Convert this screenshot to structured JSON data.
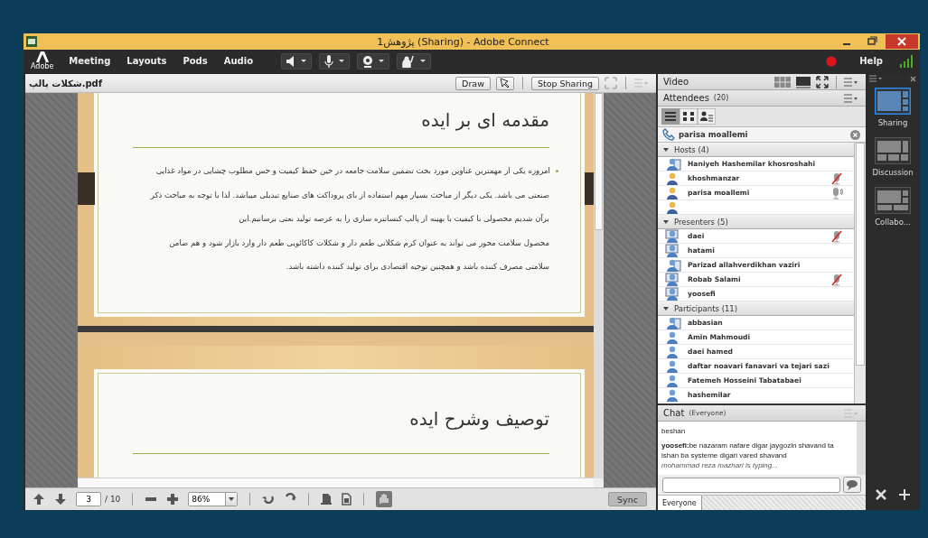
{
  "window": {
    "title": "پژوهش1 (Sharing) - Adobe Connect",
    "logo": "Adobe"
  },
  "menu": [
    "Meeting",
    "Layouts",
    "Pods",
    "Audio"
  ],
  "help": "Help",
  "share_pod": {
    "file": "شكلات پالپ.pdf",
    "buttons": [
      "Draw",
      "Stop Sharing"
    ],
    "slides": [
      {
        "title": "مقدمه ای بر ایده",
        "lines": [
          "امروزه یکی از مهمترین عناوین مورد بحث تضمین سلامت جامعه در حین حفظ کیفیت و حس مطلوب چشایی در مواد غذایی",
          "صنعتی می باشد. یکی دیگر از مباحث بسیار مهم استفاده از بای پروداکت های صنایع تبدیلی میباشد. لذا با توجه به مباحث ذکر",
          "برآن شدیم    محصولی با کیفیت با           بهینه از پالپ           کنسانتره سازی را به عرصه تولید    نعتی برسانیم.این",
          "محصول سلامت محور می تواند به عنوان کرم شکلاتی طعم دار و شکلات کاکائویی طعم دار وارد بازار شود و هم ضامن",
          "سلامتی مصرف کننده باشد و همچنین توجیه اقتصادی برای تولید کننده داشته باشد."
        ]
      },
      {
        "title": "توصیف وشرح ایده"
      }
    ],
    "page": "3",
    "total": "/ 10",
    "zoom": "86%",
    "sync": "Sync"
  },
  "video": {
    "title": "Video"
  },
  "attendees": {
    "title": "Attendees",
    "count": "(20)",
    "caller": "parisa moallemi",
    "groups": [
      {
        "name": "Hosts (4)",
        "expanded": true,
        "members": [
          {
            "name": "Haniyeh Hashemilar khosroshahi",
            "kind": "device",
            "muted": false,
            "speaking": false
          },
          {
            "name": "khoshmanzar",
            "kind": "host",
            "muted": true,
            "speaking": false
          },
          {
            "name": "parisa moallemi",
            "kind": "host",
            "muted": false,
            "speaking": true
          },
          {
            "kind": "host",
            "muted": false,
            "speaking": false
          }
        ]
      },
      {
        "name": "Presenters (5)",
        "expanded": true,
        "members": [
          {
            "name": "daei",
            "kind": "presenter",
            "muted": true,
            "speaking": false
          },
          {
            "name": "hatami",
            "kind": "presenter",
            "muted": false,
            "speaking": false
          },
          {
            "name": "Parizad allahverdikhan vaziri",
            "kind": "device",
            "muted": false,
            "speaking": false
          },
          {
            "name": "Robab Salami",
            "kind": "presenter",
            "muted": true,
            "speaking": false
          },
          {
            "name": "yoosefi",
            "kind": "presenter",
            "muted": false,
            "speaking": false
          }
        ]
      },
      {
        "name": "Participants (11)",
        "expanded": true,
        "members": [
          {
            "name": "abbasian",
            "kind": "device",
            "muted": false,
            "speaking": false
          },
          {
            "name": "Amin Mahmoudi",
            "kind": "participant",
            "muted": false,
            "speaking": false
          },
          {
            "name": "daei hamed",
            "kind": "participant",
            "muted": false,
            "speaking": false
          },
          {
            "name": "daftar noavari fanavari va tejari sazi",
            "kind": "participant",
            "muted": false,
            "speaking": false
          },
          {
            "name": "Fatemeh Hosseini Tabatabaei",
            "kind": "participant",
            "muted": false,
            "speaking": false
          },
          {
            "name": "hashemilar",
            "kind": "participant",
            "muted": false,
            "speaking": false
          }
        ]
      }
    ]
  },
  "chat": {
    "title": "Chat",
    "scope": "(Everyone)",
    "messages": [
      {
        "text": "beshan"
      },
      {
        "sender": "yoosefi:",
        "text": "be nazaram nafare digar jaygozin shavand ta ishan ba systeme digari vared shavand"
      }
    ],
    "typing": "mohammad reza mazhari is typing...",
    "tab": "Everyone"
  },
  "layouts": [
    {
      "label": "Sharing",
      "selected": true,
      "kind": "sharing"
    },
    {
      "label": "Discussion",
      "selected": false,
      "kind": "discussion"
    },
    {
      "label": "Collabo...",
      "selected": false,
      "kind": "collab"
    }
  ]
}
